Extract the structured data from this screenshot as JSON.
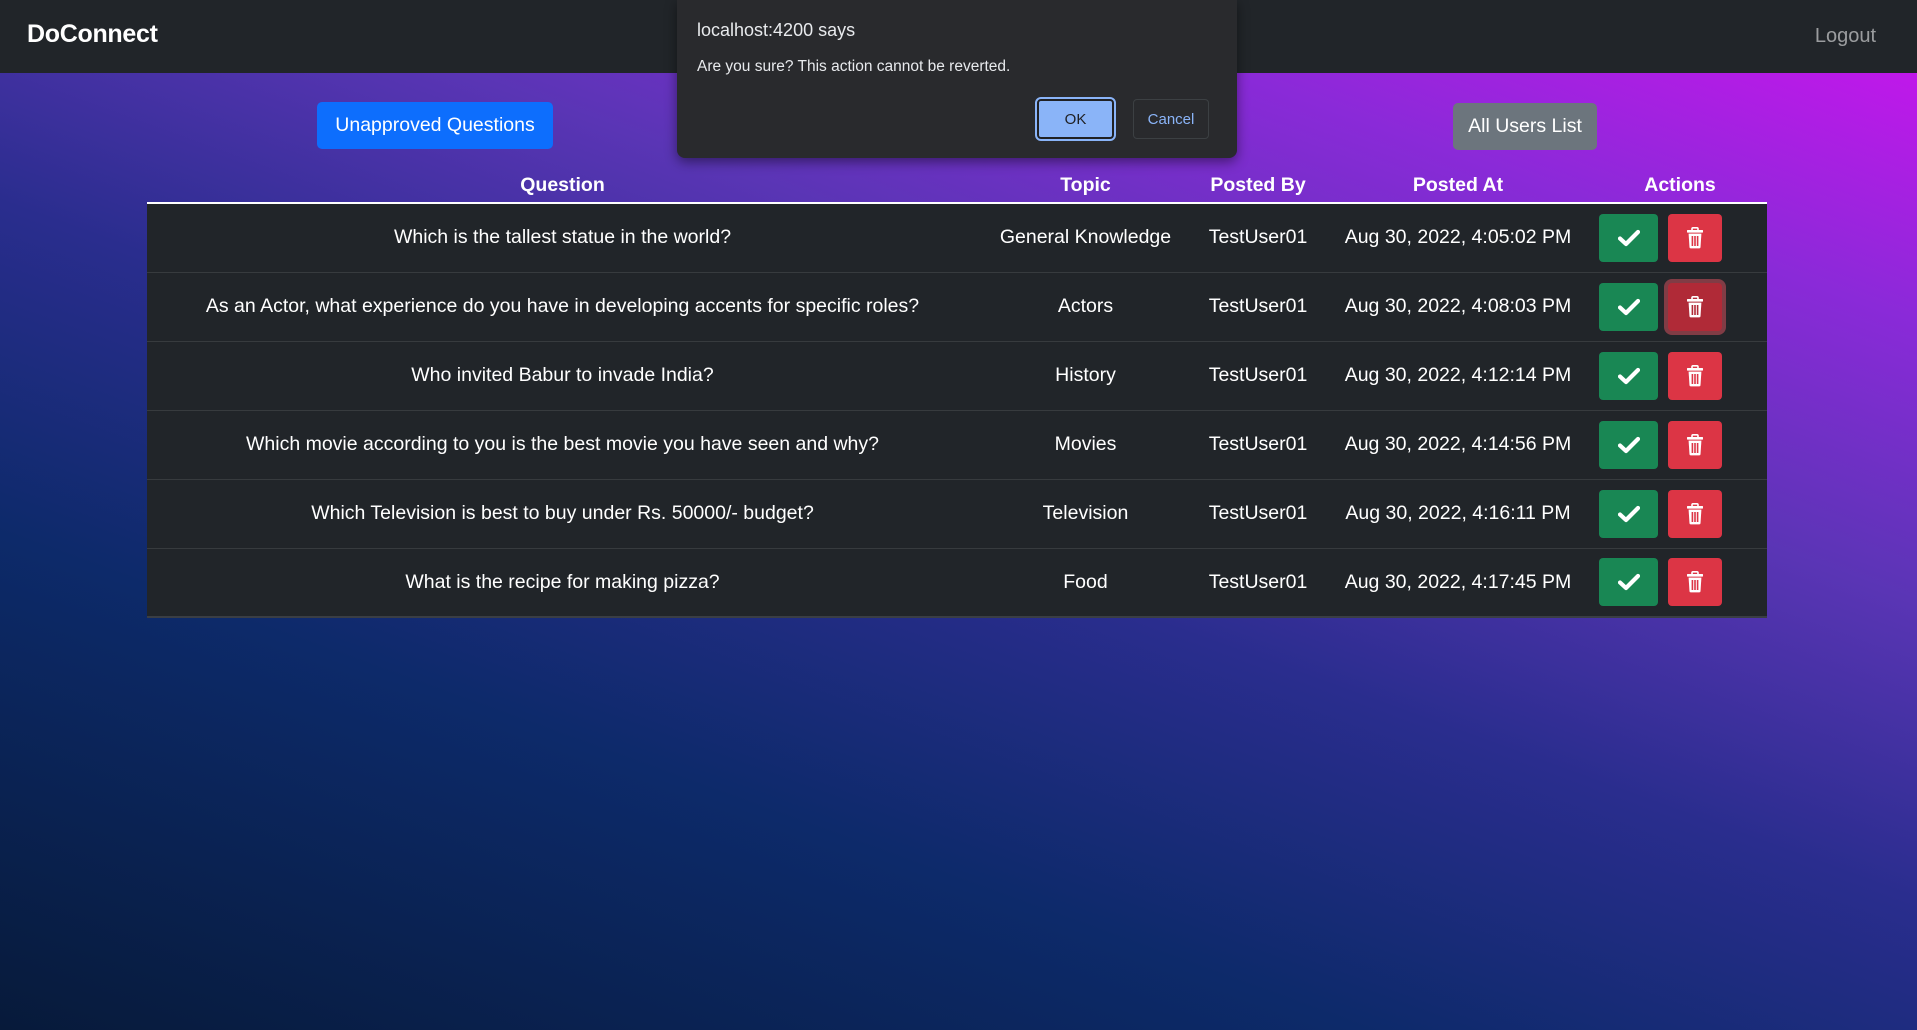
{
  "navbar": {
    "brand": "DoConnect",
    "logout_label": "Logout"
  },
  "toolbar": {
    "unapproved_questions_label": "Unapproved Questions",
    "all_users_list_label": "All Users List"
  },
  "table": {
    "columns": [
      "Question",
      "Topic",
      "Posted By",
      "Posted At",
      "Actions"
    ],
    "rows": [
      {
        "question": "Which is the tallest statue in the world?",
        "topic": "General Knowledge",
        "posted_by": "TestUser01",
        "posted_at": "Aug 30, 2022, 4:05:02 PM"
      },
      {
        "question": "As an Actor, what experience do you have in developing accents for specific roles?",
        "topic": "Actors",
        "posted_by": "TestUser01",
        "posted_at": "Aug 30, 2022, 4:08:03 PM"
      },
      {
        "question": "Who invited Babur to invade India?",
        "topic": "History",
        "posted_by": "TestUser01",
        "posted_at": "Aug 30, 2022, 4:12:14 PM"
      },
      {
        "question": "Which movie according to you is the best movie you have seen and why?",
        "topic": "Movies",
        "posted_by": "TestUser01",
        "posted_at": "Aug 30, 2022, 4:14:56 PM"
      },
      {
        "question": "Which Television is best to buy under Rs. 50000/- budget?",
        "topic": "Television",
        "posted_by": "TestUser01",
        "posted_at": "Aug 30, 2022, 4:16:11 PM"
      },
      {
        "question": "What is the recipe for making pizza?",
        "topic": "Food",
        "posted_by": "TestUser01",
        "posted_at": "Aug 30, 2022, 4:17:45 PM"
      }
    ],
    "actions": {
      "approve_icon": "check-icon",
      "delete_icon": "trash-icon",
      "focused_delete_row": 2
    }
  },
  "dialog": {
    "title": "localhost:4200 says",
    "message": "Are you sure? This action cannot be reverted.",
    "ok_label": "OK",
    "cancel_label": "Cancel"
  },
  "colors": {
    "navbar": "#212529",
    "primary": "#0d6efd",
    "secondary": "#6c757d",
    "success": "#198754",
    "danger": "#dc3545",
    "table_row": "#212529",
    "dialog_bg": "#292a2d",
    "dialog_accent": "#8ab4f8"
  }
}
